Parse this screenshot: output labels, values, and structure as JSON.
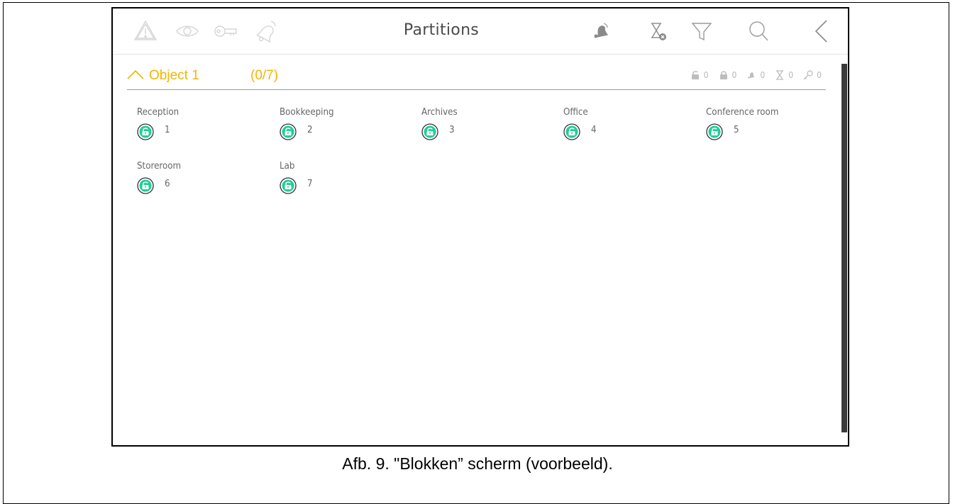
{
  "screen": {
    "title": "Partitions",
    "toolbar_left_icons": [
      "warning-icon",
      "eye-icon",
      "key-icon",
      "bell-icon"
    ],
    "toolbar_right_icons": [
      "alarm-bell-icon",
      "hourglass-cancel-icon",
      "filter-icon",
      "search-icon",
      "back-icon"
    ]
  },
  "object": {
    "name": "Object 1",
    "count": "(0/7)",
    "summary": [
      {
        "icon": "unlocked-icon",
        "value": "0"
      },
      {
        "icon": "locked-icon",
        "value": "0"
      },
      {
        "icon": "alarm-bell-icon",
        "value": "0"
      },
      {
        "icon": "hourglass-icon",
        "value": "0"
      },
      {
        "icon": "key-icon",
        "value": "0"
      }
    ]
  },
  "partitions": [
    {
      "name": "Reception",
      "number": "1",
      "state": "unlocked"
    },
    {
      "name": "Bookkeeping",
      "number": "2",
      "state": "unlocked"
    },
    {
      "name": "Archives",
      "number": "3",
      "state": "unlocked"
    },
    {
      "name": "Office",
      "number": "4",
      "state": "unlocked"
    },
    {
      "name": "Conference room",
      "number": "5",
      "state": "unlocked"
    },
    {
      "name": "Storeroom",
      "number": "6",
      "state": "unlocked"
    },
    {
      "name": "Lab",
      "number": "7",
      "state": "unlocked"
    }
  ],
  "colors": {
    "accent": "#f4b400",
    "unlocked_green": "#1ecf9a",
    "icon_grey": "#d0d0d0",
    "text_grey": "#666666"
  },
  "caption": "Afb. 9. \"Blokken” scherm (voorbeeld)."
}
